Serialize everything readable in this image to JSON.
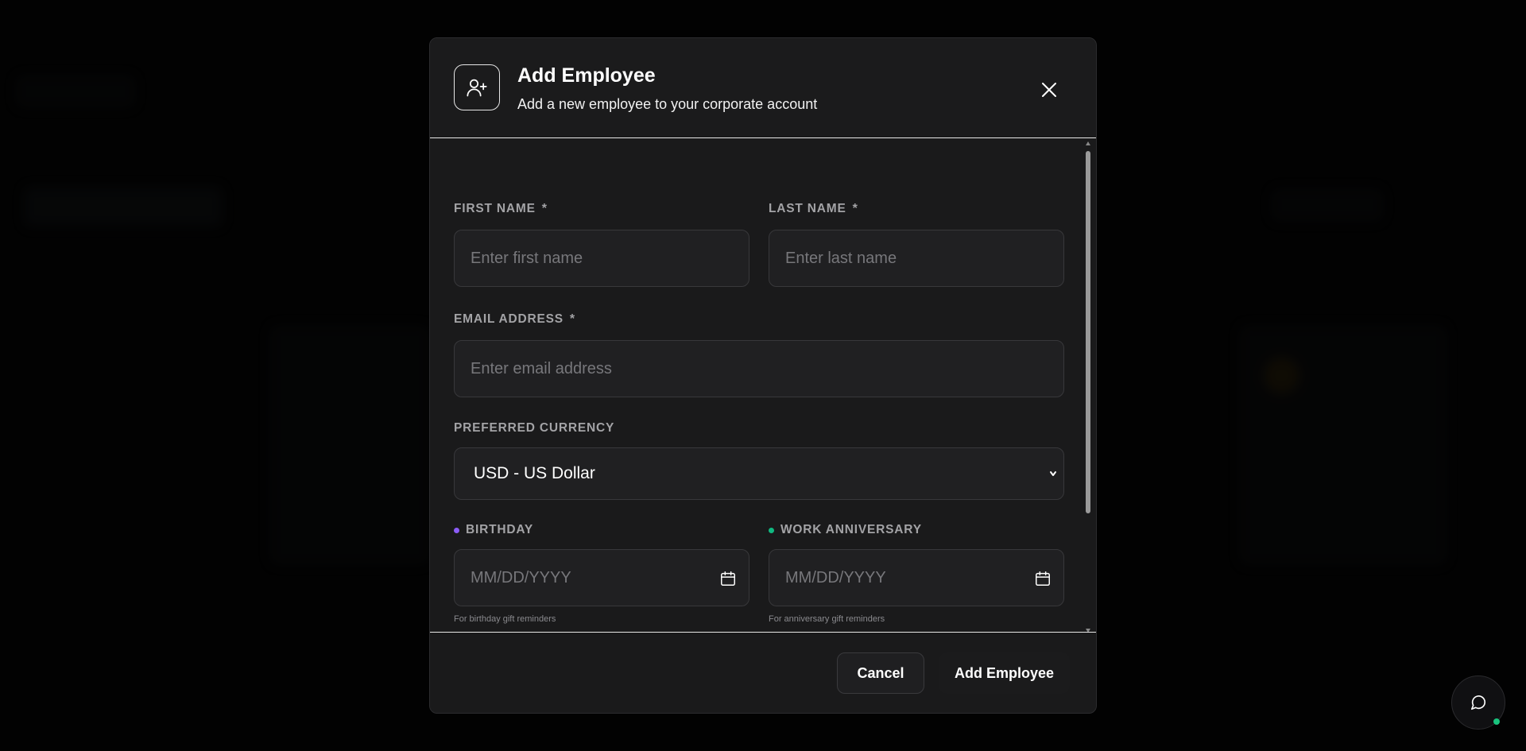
{
  "modal": {
    "title": "Add Employee",
    "subtitle": "Add a new employee to your corporate account",
    "icon": "user-plus-icon"
  },
  "form": {
    "first_name": {
      "label": "FIRST NAME",
      "required_mark": "*",
      "placeholder": "Enter first name"
    },
    "last_name": {
      "label": "LAST NAME",
      "required_mark": "*",
      "placeholder": "Enter last name"
    },
    "email": {
      "label": "EMAIL ADDRESS",
      "required_mark": "*",
      "placeholder": "Enter email address"
    },
    "currency": {
      "label": "PREFERRED CURRENCY",
      "selected": "USD - US Dollar"
    },
    "birthday": {
      "label": "BIRTHDAY",
      "placeholder": "MM/DD/YYYY",
      "helper": "For birthday gift reminders",
      "dot_color": "#8b5cf6"
    },
    "anniversary": {
      "label": "WORK ANNIVERSARY",
      "placeholder": "MM/DD/YYYY",
      "helper": "For anniversary gift reminders",
      "dot_color": "#10b981"
    }
  },
  "footer": {
    "cancel_label": "Cancel",
    "submit_label": "Add Employee"
  },
  "chat": {
    "icon": "chat-bubble-icon",
    "status_color": "#19c37d"
  }
}
